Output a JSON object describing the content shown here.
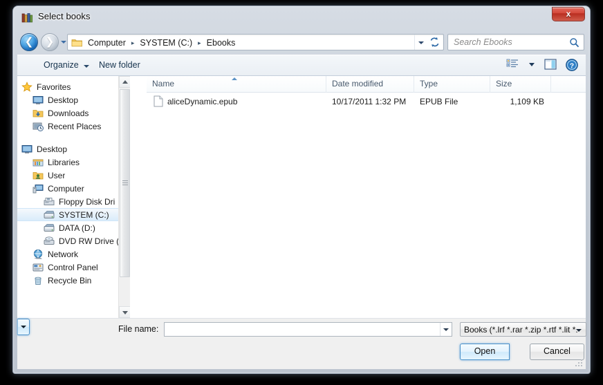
{
  "window": {
    "title": "Select books",
    "title_icon": "books-icon",
    "close_label": "x"
  },
  "nav": {
    "back_icon": "back-arrow-icon",
    "forward_icon": "forward-arrow-icon",
    "history_dropdown_icon": "chevron-down-icon",
    "folder_icon": "folder-icon",
    "breadcrumbs": [
      "Computer",
      "SYSTEM (C:)",
      "Ebooks"
    ],
    "separator": "▸",
    "path_dropdown_icon": "chevron-down-icon",
    "refresh_icon": "refresh-icon"
  },
  "search": {
    "placeholder": "Search Ebooks",
    "icon": "search-icon"
  },
  "toolbar": {
    "organize_label": "Organize",
    "organize_caret_icon": "caret-down-icon",
    "new_folder_label": "New folder",
    "view_icon": "view-mode-icon",
    "view_caret_icon": "caret-down-icon",
    "preview_pane_icon": "preview-pane-icon",
    "help_icon": "help-icon"
  },
  "sidebar": {
    "items": [
      {
        "label": "Favorites",
        "icon": "star-icon",
        "indent": 0,
        "selected": false
      },
      {
        "label": "Desktop",
        "icon": "desktop-icon",
        "indent": 1,
        "selected": false
      },
      {
        "label": "Downloads",
        "icon": "downloads-icon",
        "indent": 1,
        "selected": false
      },
      {
        "label": "Recent Places",
        "icon": "recent-places-icon",
        "indent": 1,
        "selected": false
      },
      {
        "label": "Desktop",
        "icon": "desktop-icon",
        "indent": 0,
        "selected": false,
        "gap_before": true
      },
      {
        "label": "Libraries",
        "icon": "libraries-icon",
        "indent": 1,
        "selected": false
      },
      {
        "label": "User",
        "icon": "user-icon",
        "indent": 1,
        "selected": false
      },
      {
        "label": "Computer",
        "icon": "computer-icon",
        "indent": 1,
        "selected": false
      },
      {
        "label": "Floppy Disk Dri",
        "icon": "floppy-drive-icon",
        "indent": 2,
        "selected": false
      },
      {
        "label": "SYSTEM (C:)",
        "icon": "hard-drive-icon",
        "indent": 2,
        "selected": true
      },
      {
        "label": "DATA (D:)",
        "icon": "hard-drive-icon",
        "indent": 2,
        "selected": false
      },
      {
        "label": "DVD RW Drive (",
        "icon": "dvd-drive-icon",
        "indent": 2,
        "selected": false
      },
      {
        "label": "Network",
        "icon": "network-icon",
        "indent": 1,
        "selected": false
      },
      {
        "label": "Control Panel",
        "icon": "control-panel-icon",
        "indent": 1,
        "selected": false
      },
      {
        "label": "Recycle Bin",
        "icon": "recycle-bin-icon",
        "indent": 1,
        "selected": false
      }
    ],
    "scrollbar": {
      "up_icon": "scroll-up-icon",
      "down_icon": "scroll-down-icon"
    }
  },
  "file_list": {
    "columns": [
      {
        "label": "Name",
        "sorted": true,
        "sort_direction": "ascending"
      },
      {
        "label": "Date modified",
        "sorted": false,
        "sort_direction": ""
      },
      {
        "label": "Type",
        "sorted": false,
        "sort_direction": ""
      },
      {
        "label": "Size",
        "sorted": false,
        "sort_direction": ""
      }
    ],
    "rows": [
      {
        "icon": "file-icon",
        "name": "aliceDynamic.epub",
        "date_modified": "10/17/2011 1:32 PM",
        "type": "EPUB File",
        "size": "1,109 KB"
      }
    ]
  },
  "footer": {
    "file_name_label": "File name:",
    "file_name_value": "",
    "file_name_dropdown_icon": "chevron-down-icon",
    "filter_value": "Books (*.lrf *.rar *.zip *.rtf *.lit *.",
    "filter_dropdown_icon": "chevron-down-icon",
    "open_label": "Open",
    "open_dropdown_icon": "caret-down-icon",
    "cancel_label": "Cancel",
    "resize_grip_icon": "resize-grip-icon"
  },
  "colors": {
    "accent": "#4a90c8",
    "close_button": "#b92d20",
    "selection": "#d9ecfb",
    "header_text": "#46586b"
  }
}
